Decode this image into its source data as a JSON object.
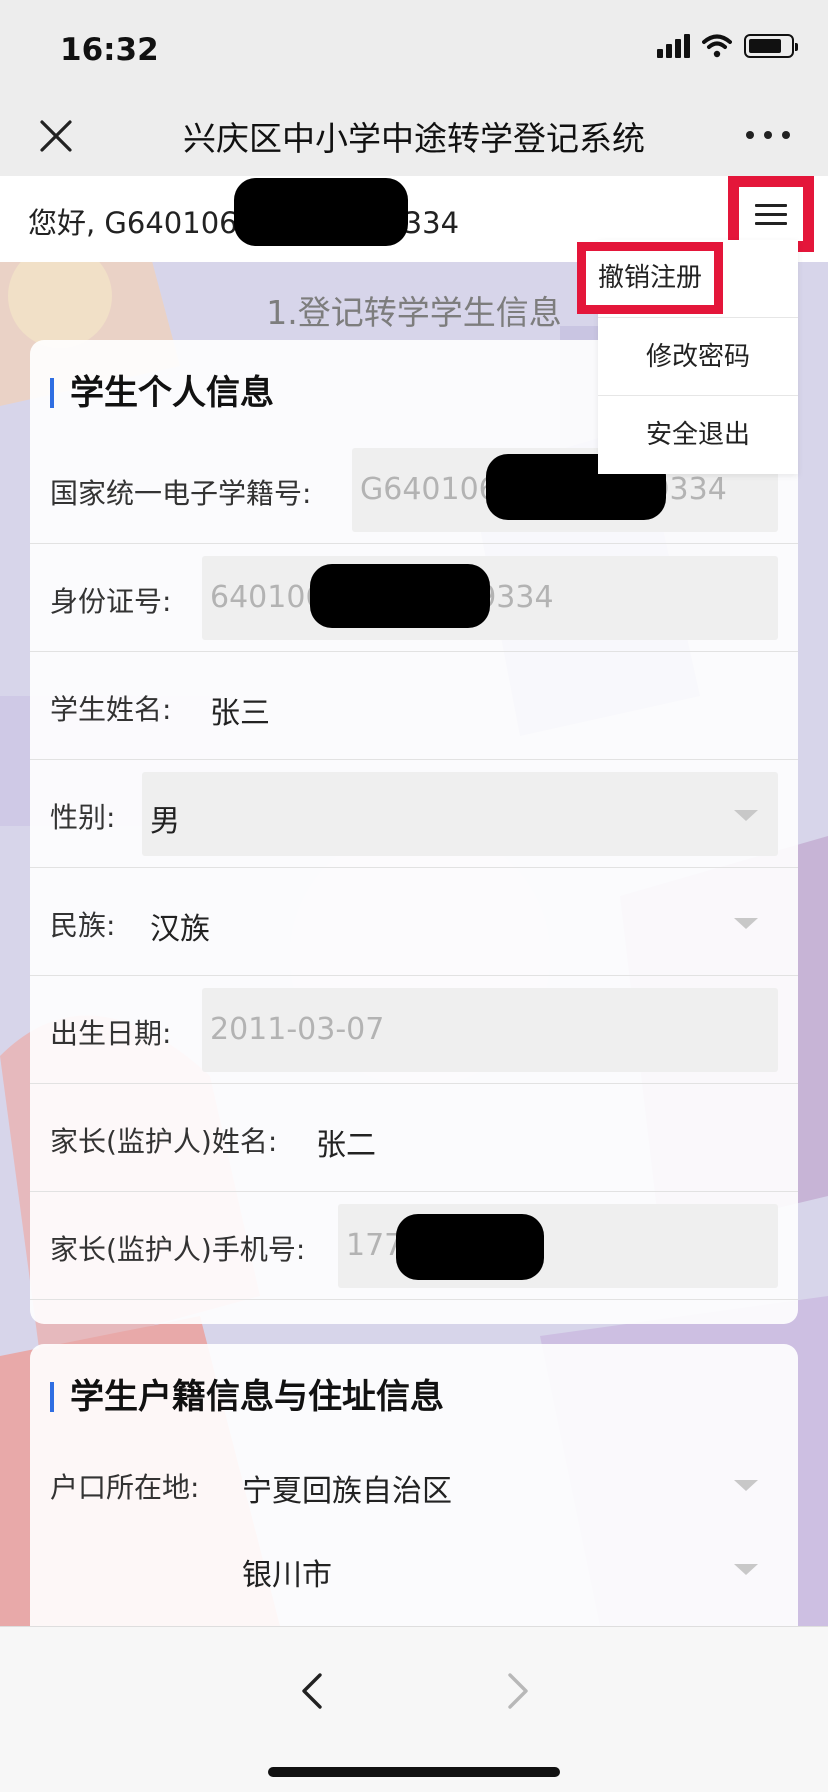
{
  "status_bar": {
    "time": "16:32",
    "battery_level": 0.8
  },
  "nav": {
    "title": "兴庆区中小学中途转学登记系统"
  },
  "greeting": {
    "text": "您好, G640106201103079334"
  },
  "menu": {
    "items": [
      {
        "label": "撤销注册",
        "highlighted": true
      },
      {
        "label": "修改密码",
        "highlighted": false
      },
      {
        "label": "安全退出",
        "highlighted": false
      }
    ]
  },
  "page": {
    "section_heading": "1.登记转学学生信息"
  },
  "personal_info": {
    "title": "学生个人信息",
    "fields": [
      {
        "label": "国家统一电子学籍号:",
        "value": "G640106201103079334"
      },
      {
        "label": "身份证号:",
        "value": "640106201103079334"
      },
      {
        "label": "学生姓名:",
        "value": "张三"
      },
      {
        "label": "性别:",
        "value": "男"
      },
      {
        "label": "民族:",
        "value": "汉族"
      },
      {
        "label": "出生日期:",
        "value": "2011-03-07"
      },
      {
        "label": "家长(监护人)姓名:",
        "value": "张二"
      },
      {
        "label": "家长(监护人)手机号:",
        "value": "177"
      }
    ]
  },
  "residence_info": {
    "title": "学生户籍信息与住址信息",
    "fields": [
      {
        "label": "户口所在地:",
        "province": "宁夏回族自治区",
        "city": "银川市"
      }
    ]
  },
  "colors": {
    "highlight_red": "#e4163a",
    "accent_blue": "#2f6ee2"
  }
}
